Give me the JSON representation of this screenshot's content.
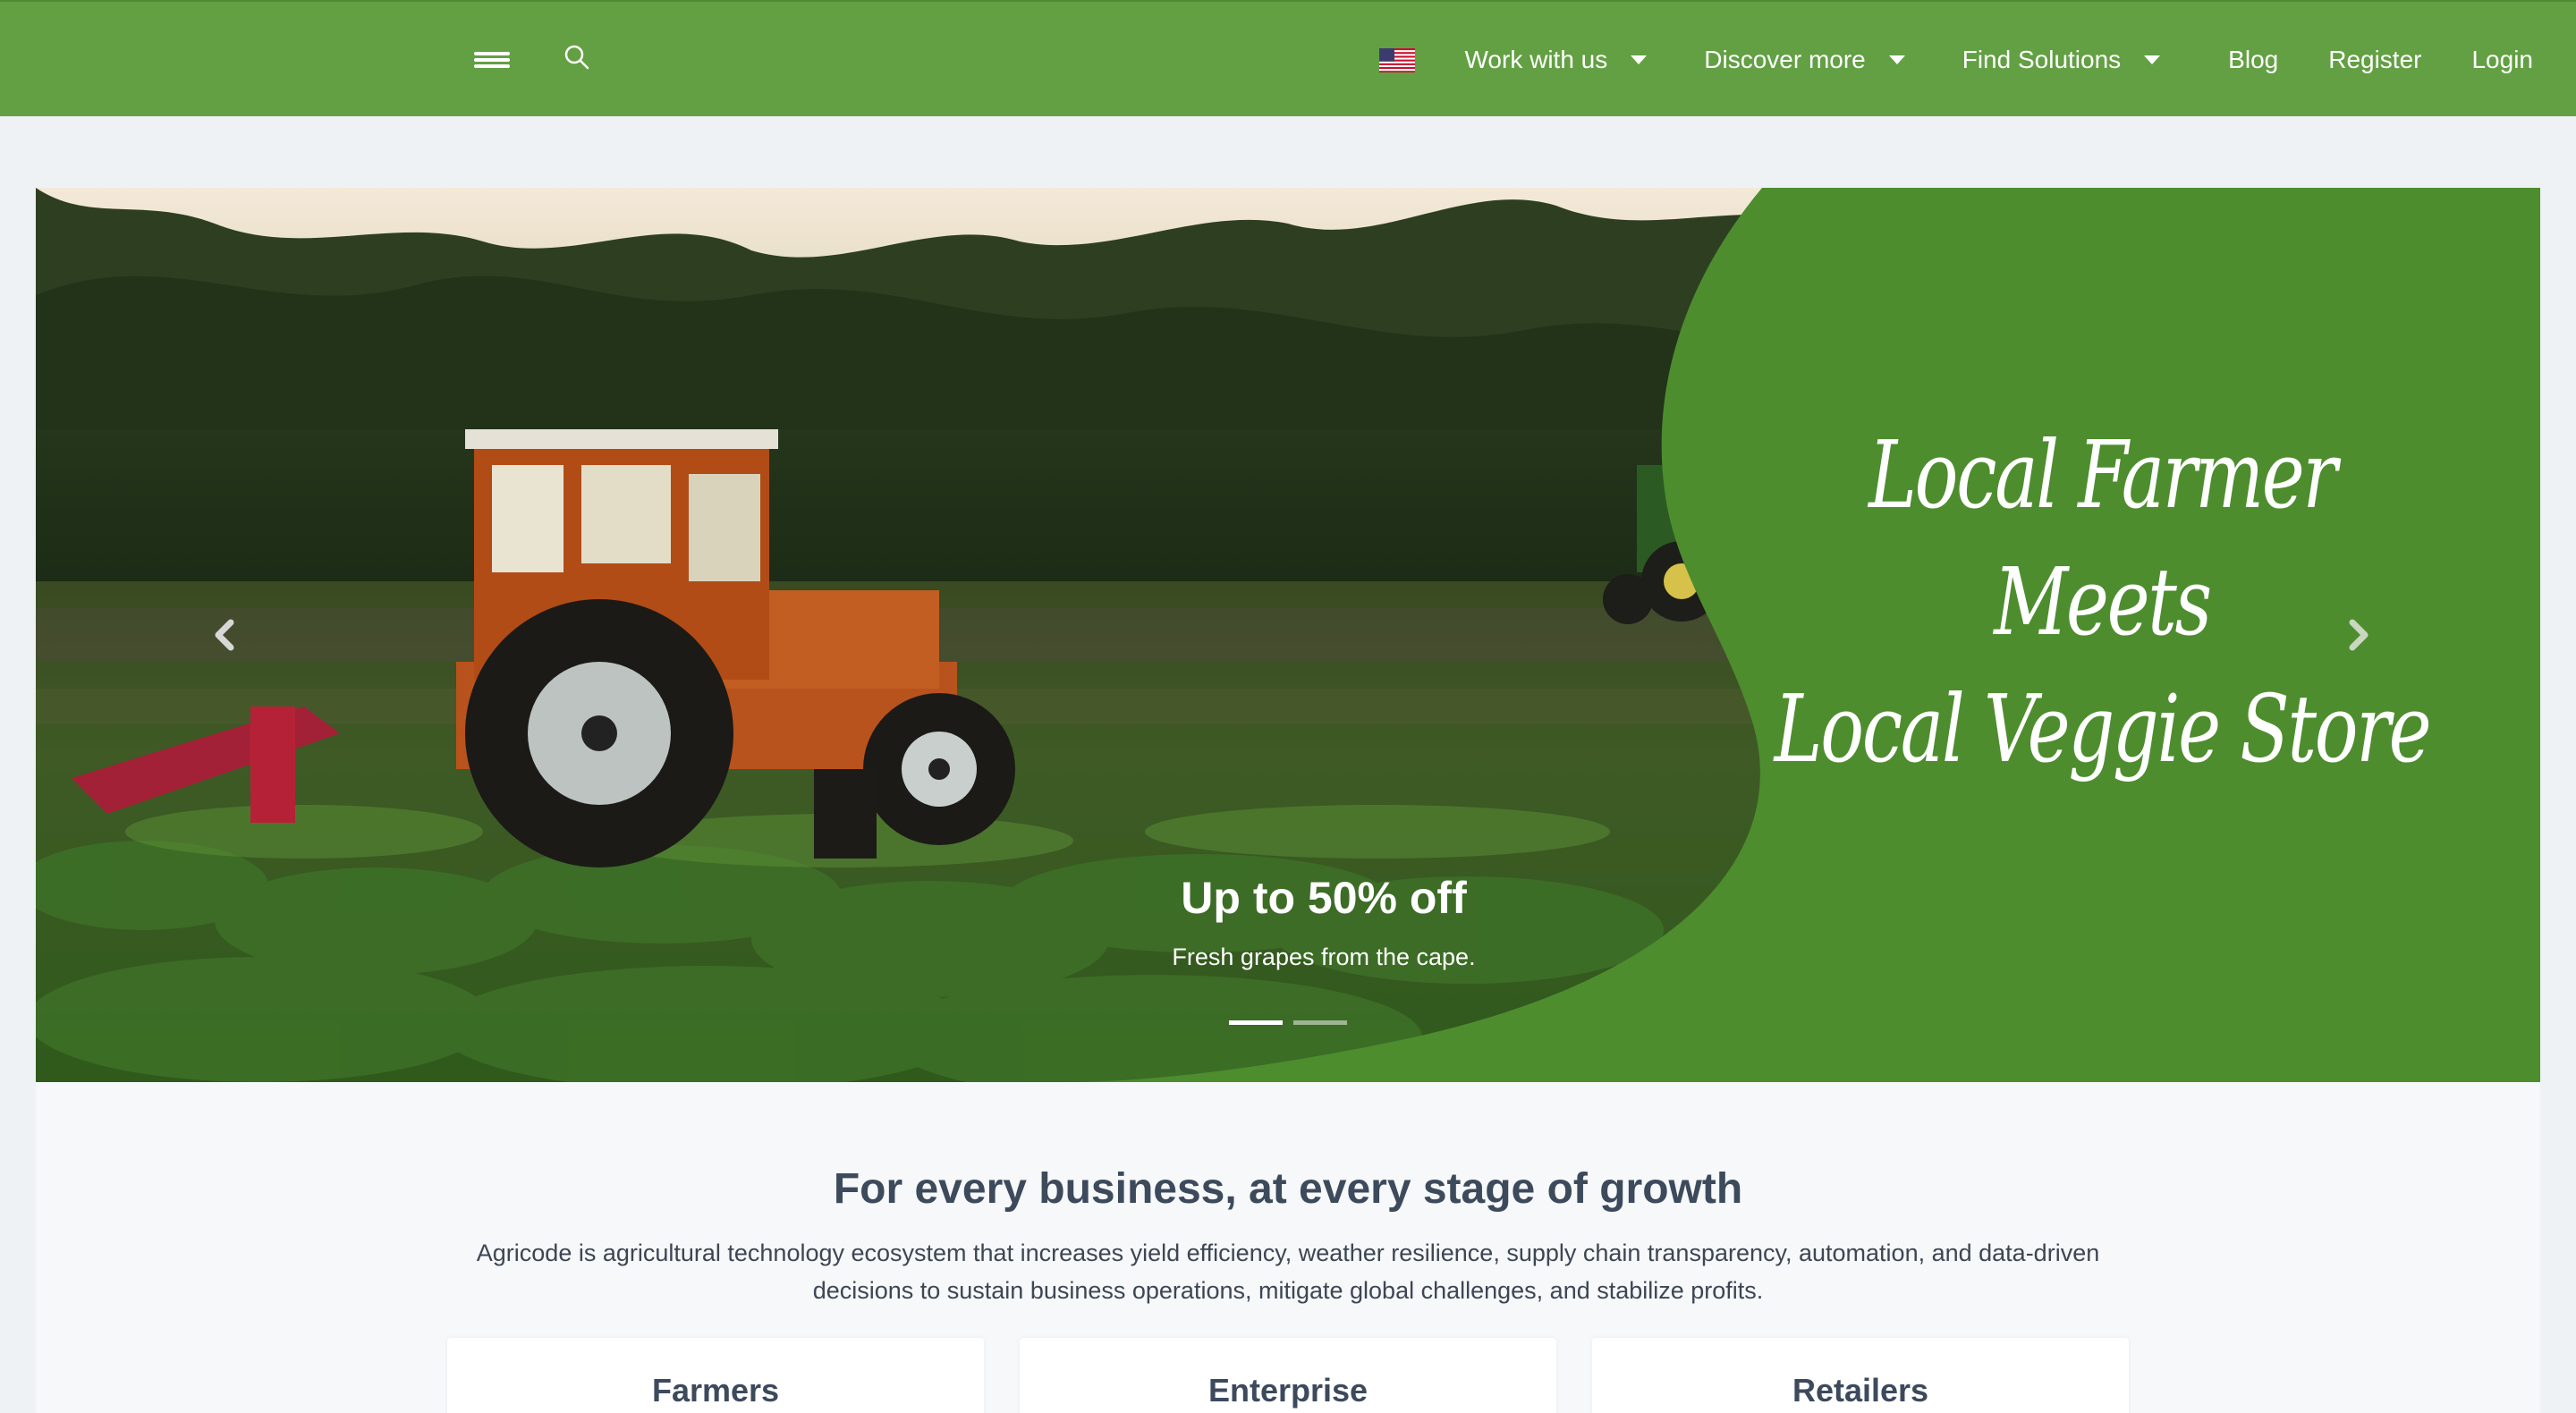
{
  "nav": {
    "menu_icon": "hamburger-menu-icon",
    "search_icon": "search-icon",
    "language_flag": "us-flag-icon",
    "dropdowns": [
      {
        "label": "Work with us"
      },
      {
        "label": "Discover more"
      },
      {
        "label": "Find Solutions"
      }
    ],
    "links": [
      {
        "label": "Blog"
      },
      {
        "label": "Register"
      },
      {
        "label": "Login"
      }
    ]
  },
  "hero": {
    "slogan_lines": [
      "Local Farmer",
      "Meets",
      "Local Veggie Store"
    ],
    "caption_title": "Up to 50% off",
    "caption_text": "Fresh grapes from the cape.",
    "slide_count": 2,
    "active_slide": 1,
    "prev_icon": "chevron-left-icon",
    "next_icon": "chevron-right-icon"
  },
  "intro": {
    "title": "For every business, at every stage of growth",
    "text": "Agricode is agricultural technology ecosystem that increases yield efficiency, weather resilience, supply chain transparency, automation, and data-driven decisions to sustain business operations, mitigate global challenges, and stabilize profits."
  },
  "cards": [
    {
      "title": "Farmers"
    },
    {
      "title": "Enterprise"
    },
    {
      "title": "Retailers"
    }
  ],
  "colors": {
    "nav_green": "#62a043",
    "hero_green": "#4d8d2e",
    "heading": "#3c4a5c",
    "page_bg": "#eef2f4"
  }
}
